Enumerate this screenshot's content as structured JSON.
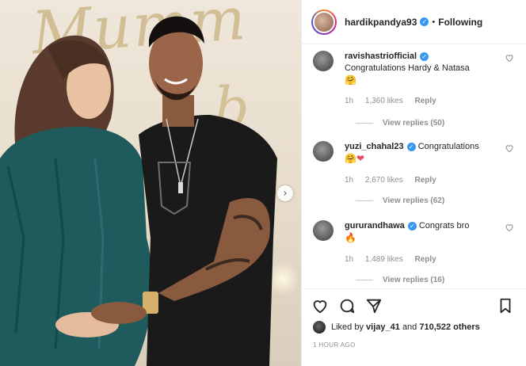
{
  "post": {
    "username": "hardikpandya93",
    "follow_status": "Following",
    "separator": "•"
  },
  "comments": [
    {
      "user": "ravishastriofficial",
      "text": "Congratulations Hardy & Natasa",
      "emoji": "🤗",
      "time": "1h",
      "likes": "1,360 likes",
      "reply": "Reply",
      "view_replies": "View replies (50)"
    },
    {
      "user": "yuzi_chahal23",
      "text": "Congratulations",
      "emoji": "🤗❤",
      "time": "1h",
      "likes": "2,670 likes",
      "reply": "Reply",
      "view_replies": "View replies (62)"
    },
    {
      "user": "gururandhawa",
      "text": "Congrats bro",
      "emoji": "🔥",
      "time": "1h",
      "likes": "1,489 likes",
      "reply": "Reply",
      "view_replies": "View replies (16)"
    }
  ],
  "likes": {
    "prefix": "Liked by",
    "user": "vijay_41",
    "connector": "and",
    "others": "710,522 others"
  },
  "timestamp": "1 HOUR AGO",
  "photo": {
    "backdrop_text_1": "Mumm",
    "backdrop_text_2": "b"
  },
  "colors": {
    "verified_blue": "#3897f0",
    "dress_teal": "#1f5a5c",
    "shirt_black": "#1a1a1a",
    "heart_red": "#ed4956"
  },
  "icons": {
    "like": "heart-outline-icon",
    "comment": "speech-bubble-icon",
    "share": "paper-plane-icon",
    "save": "bookmark-icon",
    "next": "chevron-right-icon"
  }
}
